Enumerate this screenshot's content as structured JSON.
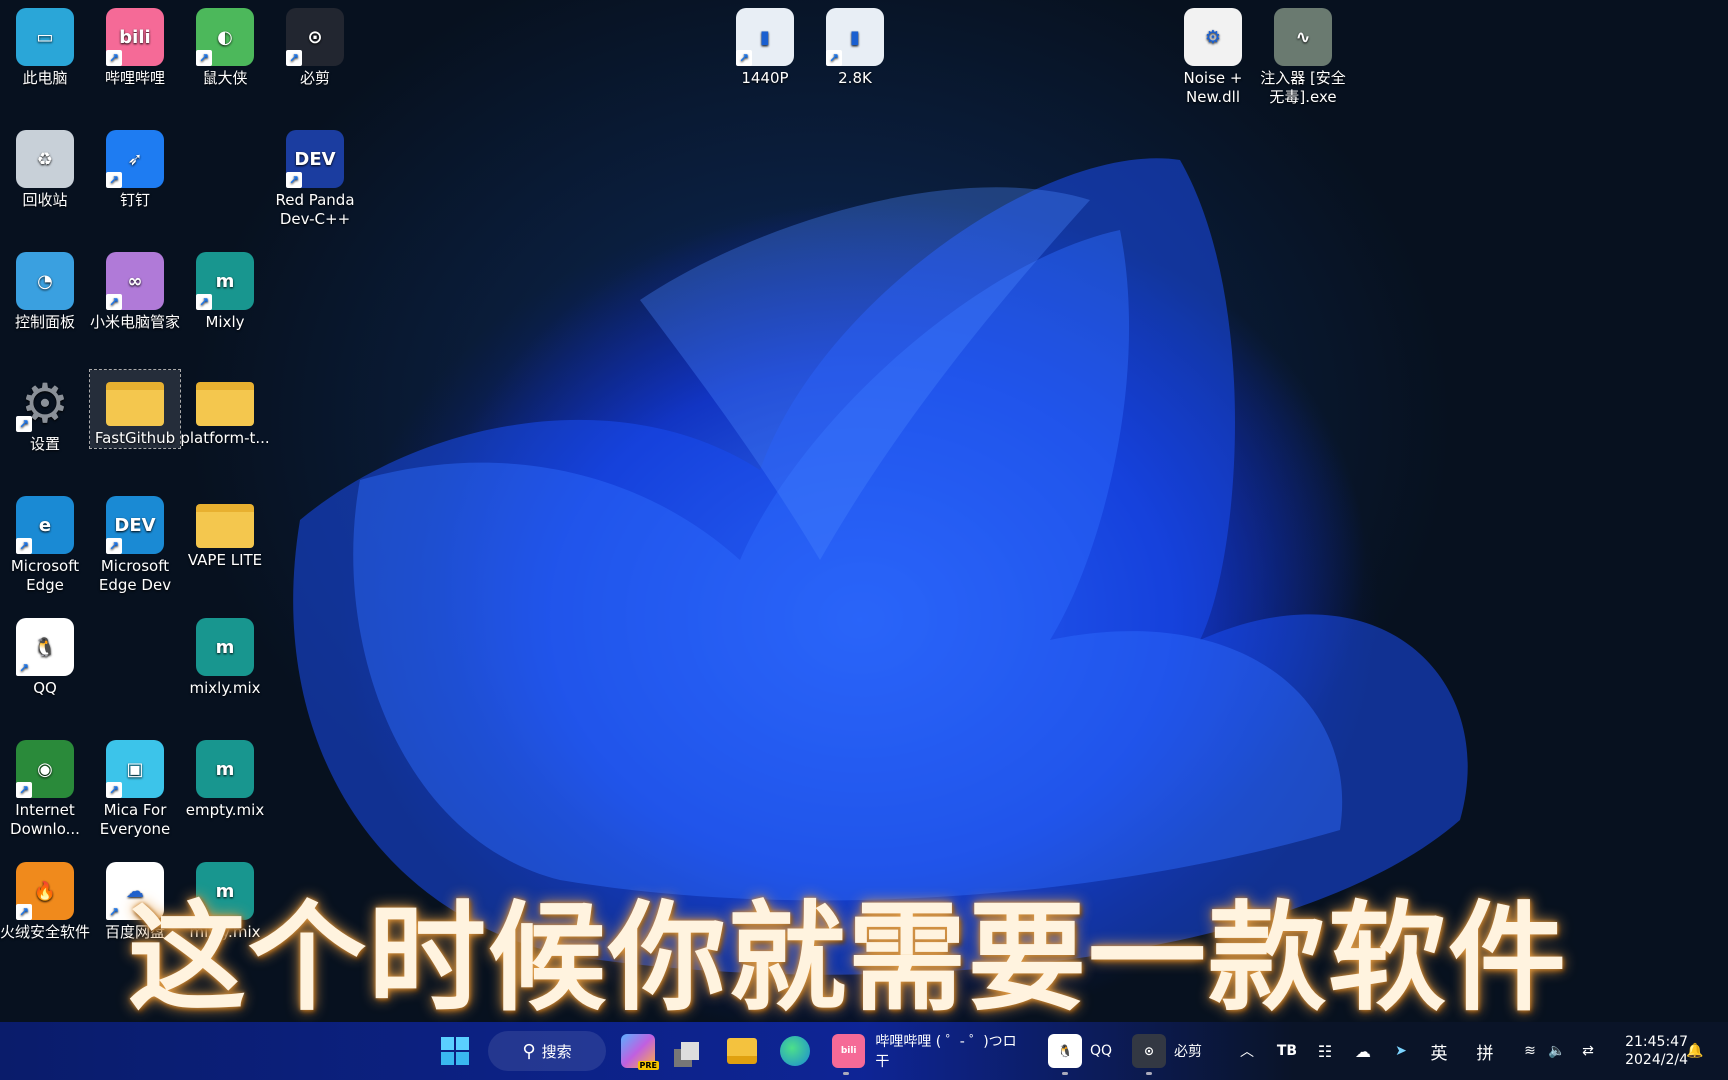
{
  "desktop_icons": [
    {
      "label": "此电脑",
      "icon": "computer-icon",
      "color": "#2aa6d8",
      "glyph": "▭",
      "shortcut": false
    },
    {
      "label": "哔哩哔哩",
      "icon": "bilibili-icon",
      "color": "#f56a97",
      "glyph": "bili",
      "shortcut": true
    },
    {
      "label": "鼠大侠",
      "icon": "mouse-shield-icon",
      "color": "#4cb85b",
      "glyph": "◐",
      "shortcut": true
    },
    {
      "label": "必剪",
      "icon": "bijian-icon",
      "color": "#222630",
      "glyph": "⊙",
      "shortcut": true
    },
    {
      "label": "回收站",
      "icon": "recycle-bin-icon",
      "color": "#c8d0d8",
      "glyph": "♻",
      "shortcut": false
    },
    {
      "label": "钉钉",
      "icon": "dingtalk-icon",
      "color": "#1e7cf2",
      "glyph": "➶",
      "shortcut": true
    },
    {
      "label": "Red Panda Dev-C++",
      "icon": "devcpp-icon",
      "color": "#1b3da0",
      "glyph": "DEV",
      "shortcut": true
    },
    {
      "label": "控制面板",
      "icon": "control-panel-icon",
      "color": "#3aa0e0",
      "glyph": "◔",
      "shortcut": false
    },
    {
      "label": "小米电脑管家",
      "icon": "xiaomi-manager-icon",
      "color": "#b07ad8",
      "glyph": "∞",
      "shortcut": true
    },
    {
      "label": "Mixly",
      "icon": "mixly-icon",
      "color": "#18968f",
      "glyph": "m",
      "shortcut": true
    },
    {
      "label": "设置",
      "icon": "settings-gear-icon",
      "color": "transparent",
      "glyph": "⚙",
      "shortcut": true
    },
    {
      "label": "FastGithub",
      "icon": "folder-icon",
      "color": "#f4c74e",
      "glyph": "",
      "shortcut": false
    },
    {
      "label": "platform-t...",
      "icon": "folder-icon",
      "color": "#f4c74e",
      "glyph": "",
      "shortcut": false
    },
    {
      "label": "Microsoft Edge",
      "icon": "edge-icon",
      "color": "#1a8ad4",
      "glyph": "e",
      "shortcut": true
    },
    {
      "label": "Microsoft Edge Dev",
      "icon": "edge-dev-icon",
      "color": "#1a8ad4",
      "glyph": "DEV",
      "shortcut": true
    },
    {
      "label": "VAPE LITE",
      "icon": "folder-icon",
      "color": "#f4c74e",
      "glyph": "",
      "shortcut": false
    },
    {
      "label": "QQ",
      "icon": "qq-icon",
      "color": "#ffffff",
      "glyph": "🐧",
      "shortcut": true
    },
    {
      "label": "mixly.mix",
      "icon": "mixly-icon",
      "color": "#18968f",
      "glyph": "m",
      "shortcut": false
    },
    {
      "label": "Internet Downlo...",
      "icon": "idm-icon",
      "color": "#2a8a3a",
      "glyph": "◉",
      "shortcut": true
    },
    {
      "label": "Mica For Everyone",
      "icon": "mica-icon",
      "color": "#3cc4ea",
      "glyph": "▣",
      "shortcut": true
    },
    {
      "label": "empty.mix",
      "icon": "mixly-icon",
      "color": "#18968f",
      "glyph": "m",
      "shortcut": false
    },
    {
      "label": "火绒安全软件",
      "icon": "huorong-icon",
      "color": "#f08a1c",
      "glyph": "🔥",
      "shortcut": true
    },
    {
      "label": "百度网盘",
      "icon": "baidu-netdisk-icon",
      "color": "#ffffff",
      "glyph": "☁",
      "shortcut": true
    },
    {
      "label": "mixly.mix",
      "icon": "mixly-icon",
      "color": "#18968f",
      "glyph": "m",
      "shortcut": false
    },
    {
      "label": "1440P",
      "icon": "display-shortcut-icon",
      "color": "#e8eef5",
      "glyph": "▮",
      "shortcut": true
    },
    {
      "label": "2.8K",
      "icon": "display-shortcut-icon",
      "color": "#e8eef5",
      "glyph": "▮",
      "shortcut": true
    },
    {
      "label": "Noise + New.dll",
      "icon": "dll-file-icon",
      "color": "#f2f2f2",
      "glyph": "⚙",
      "shortcut": false
    },
    {
      "label": "注入器 [安全无毒].exe",
      "icon": "exe-monitor-icon",
      "color": "#6a7a70",
      "glyph": "∿",
      "shortcut": false
    }
  ],
  "subtitle": "这个时候你就需要一款软件",
  "taskbar": {
    "search_label": "搜索",
    "copilot_badge": "PRE",
    "bilibili_window": "哔哩哔哩 ( ゜- ゜)つロ 干",
    "qq_window": "QQ",
    "bijian_window": "必剪",
    "ime_lang": "英",
    "ime_mode": "拼",
    "tray_tb": "TB",
    "time": "21:45:47",
    "date": "2024/2/4"
  }
}
